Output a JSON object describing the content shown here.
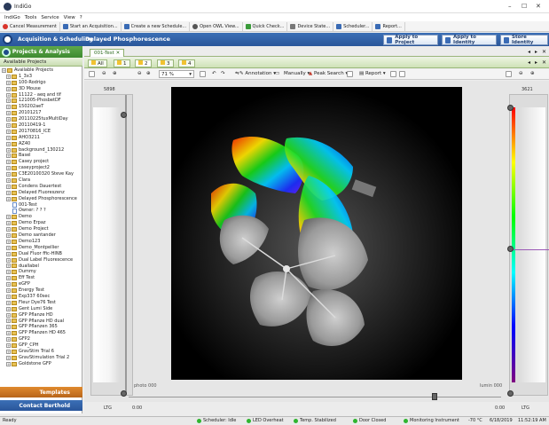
{
  "window": {
    "title": "IndiGo",
    "min": "–",
    "max": "☐",
    "close": "✕"
  },
  "menu": [
    "IndiGo",
    "Tools",
    "Service",
    "View",
    "?"
  ],
  "toolbar": [
    {
      "label": "Cancel Measurement",
      "icon": "cancel-icon",
      "color": "#d9342b"
    },
    {
      "label": "Start an Acquisition...",
      "icon": "camera-icon",
      "color": "#3a6bb5"
    },
    {
      "label": "Create a new Schedule...",
      "icon": "schedule-icon",
      "color": "#3a6bb5"
    },
    {
      "label": "Open OWL View...",
      "icon": "owl-icon",
      "color": "#555555"
    },
    {
      "label": "Quick Check...",
      "icon": "check-icon",
      "color": "#3a9b3a"
    },
    {
      "label": "Device State...",
      "icon": "device-icon",
      "color": "#777777"
    },
    {
      "label": "Scheduler...",
      "icon": "scheduler-icon",
      "color": "#3a6bb5"
    },
    {
      "label": "Report...",
      "icon": "report-icon",
      "color": "#3a6bb5"
    }
  ],
  "acq": {
    "label": "Acquisition & Scheduling",
    "title": "Delayed Phosphorescence",
    "apply_project": "Apply to Project",
    "apply_identity": "Apply to Identity",
    "store_identity": "Store Identity"
  },
  "left": {
    "projects_header": "Projects & Analysis",
    "available": "Available Projects",
    "templates": "Templates",
    "contact": "Contact Berthold",
    "items": [
      {
        "label": "Available Projects",
        "type": "root"
      },
      {
        "label": "1_3x3",
        "type": "folder"
      },
      {
        "label": "100-Rodrigo",
        "type": "folder"
      },
      {
        "label": "3D Mouse",
        "type": "folder"
      },
      {
        "label": "11122 - aeq and tlf",
        "type": "folder"
      },
      {
        "label": "121005-PhosbetDF",
        "type": "folder"
      },
      {
        "label": "150202aeT",
        "type": "folder"
      },
      {
        "label": "20101217",
        "type": "folder"
      },
      {
        "label": "20110225tuxMultiDay",
        "type": "folder"
      },
      {
        "label": "20110419-1",
        "type": "folder"
      },
      {
        "label": "20170816_ICE",
        "type": "folder"
      },
      {
        "label": "AHO3211",
        "type": "folder"
      },
      {
        "label": "AZ40",
        "type": "folder"
      },
      {
        "label": "background_130212",
        "type": "folder"
      },
      {
        "label": "Basel",
        "type": "folder"
      },
      {
        "label": "Casey project",
        "type": "folder"
      },
      {
        "label": "caseyproject2",
        "type": "folder"
      },
      {
        "label": "C3E20100320 Steve Kay",
        "type": "folder"
      },
      {
        "label": "Clara",
        "type": "folder"
      },
      {
        "label": "Condens Dauertest",
        "type": "folder"
      },
      {
        "label": "Delayed Fluoreszenz",
        "type": "folder"
      },
      {
        "label": "Delayed Phosphorescence",
        "type": "folder"
      },
      {
        "label": "001-Test",
        "type": "doc"
      },
      {
        "label": "Owner: ? ? ?",
        "type": "doc"
      },
      {
        "label": "Demo",
        "type": "folder"
      },
      {
        "label": "Demo Erpaz",
        "type": "folder"
      },
      {
        "label": "Demo Project",
        "type": "folder"
      },
      {
        "label": "Demo santander",
        "type": "folder"
      },
      {
        "label": "Demo123",
        "type": "folder"
      },
      {
        "label": "Demo_Montpellier",
        "type": "folder"
      },
      {
        "label": "Dual Fluor ffic-HINB",
        "type": "folder"
      },
      {
        "label": "Dual Label Fluorescence",
        "type": "folder"
      },
      {
        "label": "duallabel",
        "type": "folder"
      },
      {
        "label": "Dummy",
        "type": "folder"
      },
      {
        "label": "Eff Test",
        "type": "folder"
      },
      {
        "label": "eGFP",
        "type": "folder"
      },
      {
        "label": "Energy Test",
        "type": "folder"
      },
      {
        "label": "Exp337 60sec",
        "type": "folder"
      },
      {
        "label": "Fleur Dye76 Test",
        "type": "folder"
      },
      {
        "label": "Gent Lumi Side",
        "type": "folder"
      },
      {
        "label": "GFP Pflanze HD",
        "type": "folder"
      },
      {
        "label": "GFP Pflanze HD dual",
        "type": "folder"
      },
      {
        "label": "GFP Pflanzen 365",
        "type": "folder"
      },
      {
        "label": "GFP Pflanzen HD 465",
        "type": "folder"
      },
      {
        "label": "GFP2",
        "type": "folder"
      },
      {
        "label": "GFP_CPH",
        "type": "folder"
      },
      {
        "label": "GravStim Trial 6",
        "type": "folder"
      },
      {
        "label": "GravStimulation Trial 2",
        "type": "folder"
      },
      {
        "label": "Goldstone GFP",
        "type": "folder"
      }
    ]
  },
  "main": {
    "file_tab": "001-Test",
    "subtabs": [
      {
        "label": "All"
      },
      {
        "label": "1"
      },
      {
        "label": "2"
      },
      {
        "label": "3"
      },
      {
        "label": "4"
      }
    ],
    "zoom": "71 %",
    "annotation": "Annotation",
    "manually": "Manually",
    "peak_search": "Peak Search",
    "report": "Report",
    "left_scale_top": "5898",
    "right_scale_top": "3621",
    "left_scale_bottom": "LTG",
    "right_scale_bottom": "LTG",
    "photo_label": "photo 000",
    "lumin_label": "lumin 000",
    "time_left": "0:00",
    "time_right": "0:00"
  },
  "status": {
    "ready": "Ready",
    "scheduler": "Scheduler: Idle",
    "led": "LED Overheat",
    "temp": "Temp. Stabilized",
    "door": "Door Closed",
    "monitoring": "Monitoring Instrument",
    "temp_value": "-70 °C",
    "date": "6/18/2019",
    "time": "11:52:19 AM"
  }
}
